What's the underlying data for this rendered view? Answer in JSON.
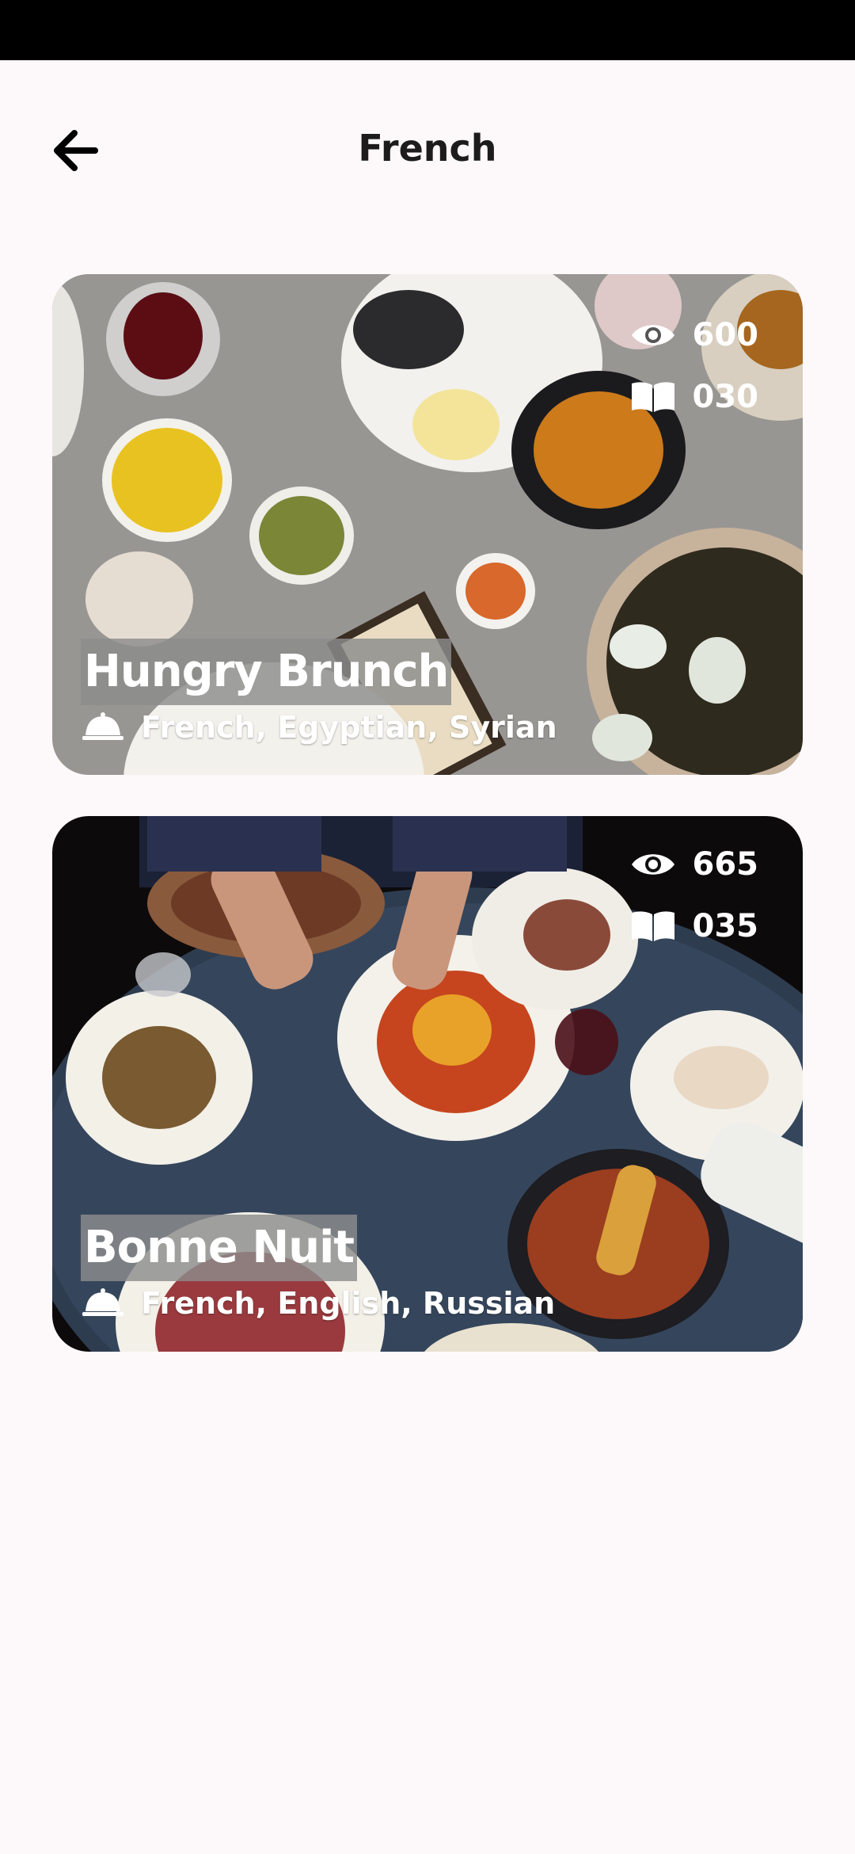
{
  "header": {
    "title": "French"
  },
  "restaurants": [
    {
      "name": "Hungry Brunch",
      "cuisines": "French, Egyptian, Syrian",
      "views": "600",
      "menus": "030"
    },
    {
      "name": "Bonne Nuit",
      "cuisines": "French, English, Russian",
      "views": "665",
      "menus": "035"
    }
  ],
  "icons": {
    "back": "arrow-left-icon",
    "views": "eye-icon",
    "menus": "book-icon",
    "cuisine": "food-cloche-icon"
  },
  "colors": {
    "background": "#fdf9fb",
    "title": "#1c1c1c",
    "label_bg": "#8c8c8c"
  }
}
